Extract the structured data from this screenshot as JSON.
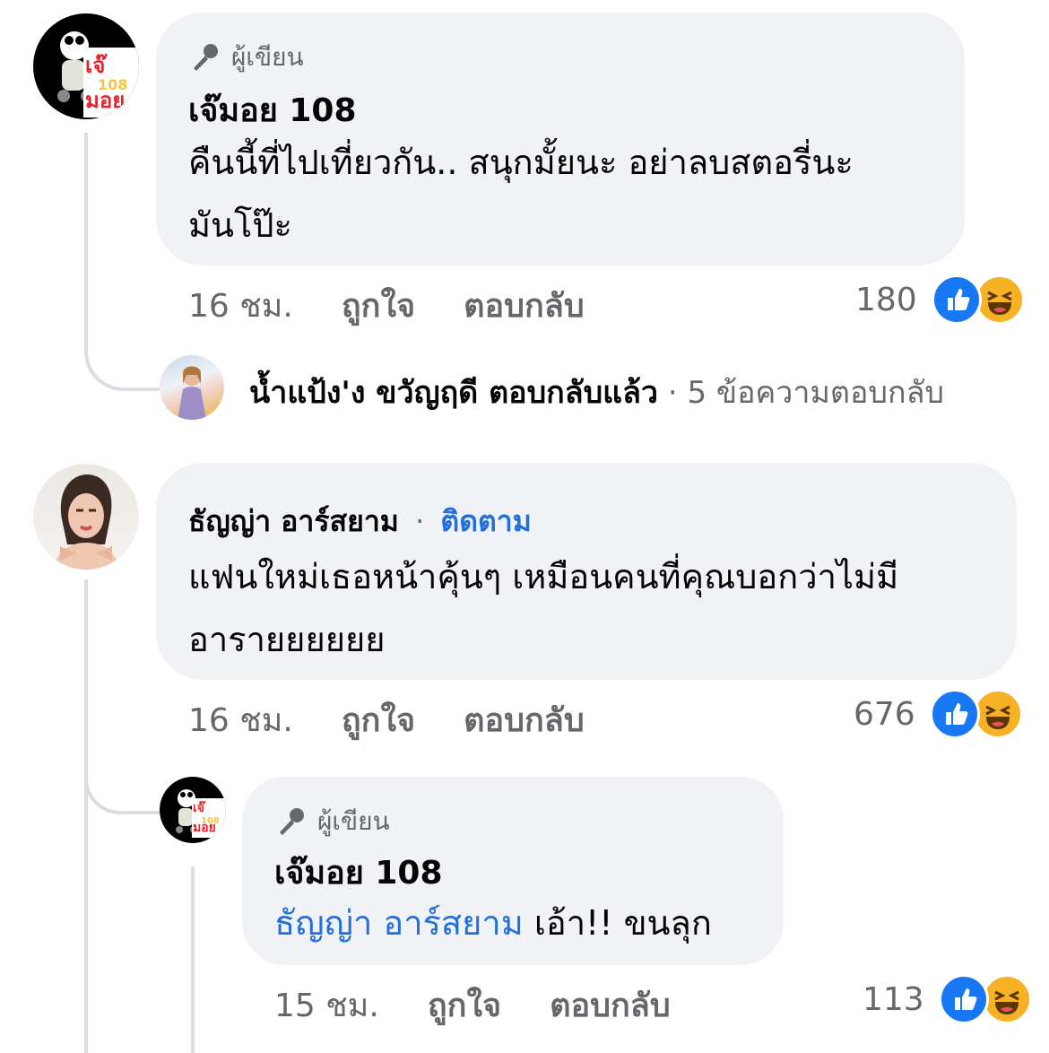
{
  "comments": [
    {
      "author_badge": "ผู้เขียน",
      "author": "เจ๊มอย 108",
      "avatar_text": "เจ๊มอย",
      "avatar_sub": "108",
      "text_line1": "คืนนี้ที่ไปเที่ยวกัน.. สนุกมั้ยนะ อย่าลบสตอรี่นะ",
      "text_line2": "มันโป๊ะ",
      "time": "16 ชม.",
      "like": "ถูกใจ",
      "reply": "ตอบกลับ",
      "reaction_count": "180",
      "replies_summary": {
        "name": "น้ำแป้ง'ง ขวัญฤดี ตอบกลับแล้ว",
        "separator": "·",
        "count_text": "5 ข้อความตอบกลับ"
      }
    },
    {
      "author": "ธัญญ่า อาร์สยาม",
      "separator": "·",
      "follow": "ติดตาม",
      "text_line1": "แฟนใหม่เธอหน้าคุ้นๆ เหมือนคนที่คุณบอกว่าไม่มี",
      "text_line2": "อารายยยยยย",
      "time": "16 ชม.",
      "like": "ถูกใจ",
      "reply": "ตอบกลับ",
      "reaction_count": "676",
      "reply_comment": {
        "author_badge": "ผู้เขียน",
        "author": "เจ๊มอย 108",
        "avatar_text": "เจ๊มอย",
        "avatar_sub": "108",
        "mention": "ธัญญ่า อาร์สยาม",
        "text": "เอ้า!! ขนลุก",
        "time": "15 ชม.",
        "like": "ถูกใจ",
        "reply": "ตอบกลับ",
        "reaction_count": "113"
      }
    }
  ],
  "colors": {
    "bubble": "#f0f2f5",
    "muted": "#65676b",
    "link": "#216fdb",
    "like_blue": "#1877f2",
    "haha_yellow": "#f7b125"
  }
}
